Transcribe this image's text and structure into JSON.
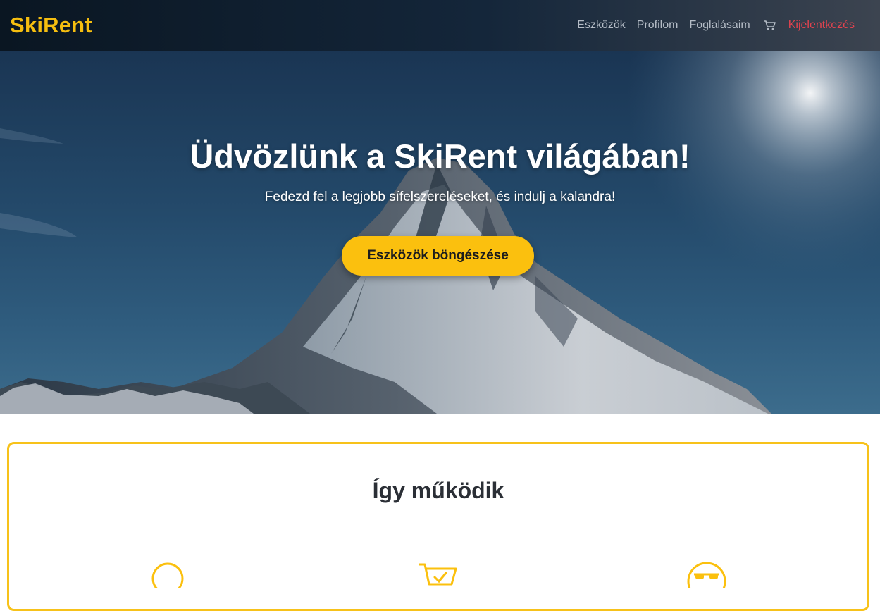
{
  "navbar": {
    "brand": "SkiRent",
    "links": [
      "Eszközök",
      "Profilom",
      "Foglalásaim"
    ],
    "cart_icon": "cart-icon",
    "logout": "Kijelentkezés"
  },
  "hero": {
    "title": "Üdvözlünk a SkiRent világában!",
    "subtitle": "Fedezd fel a legjobb sífelszereléseket, és indulj a kalandra!",
    "button_label": "Eszközök böngészése"
  },
  "how_it_works": {
    "title": "Így működik",
    "step_icons": [
      "search-icon",
      "cart-check-icon",
      "smile-sunglasses-icon"
    ]
  },
  "colors": {
    "accent": "#fbc00e",
    "logout": "#e2434f",
    "nav_link": "#b4bcc6"
  }
}
